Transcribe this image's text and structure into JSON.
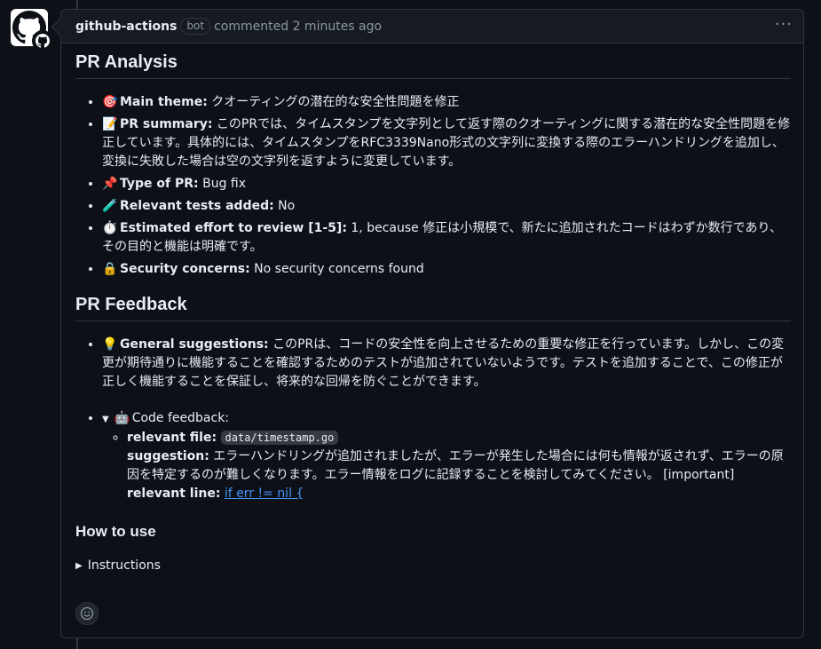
{
  "header": {
    "author": "github-actions",
    "badge": "bot",
    "time": "commented 2 minutes ago",
    "menu": "···"
  },
  "analysis": {
    "title": "PR Analysis",
    "items": [
      {
        "emoji": "🎯",
        "label": "Main theme:",
        "text": " クオーティングの潜在的な安全性問題を修正"
      },
      {
        "emoji": "📝",
        "label": "PR summary:",
        "text": " このPRでは、タイムスタンプを文字列として返す際のクオーティングに関する潜在的な安全性問題を修正しています。具体的には、タイムスタンプをRFC3339Nano形式の文字列に変換する際のエラーハンドリングを追加し、変換に失敗した場合は空の文字列を返すように変更しています。"
      },
      {
        "emoji": "📌",
        "label": "Type of PR:",
        "text": " Bug fix"
      },
      {
        "emoji": "🧪",
        "label": "Relevant tests added:",
        "text": " No"
      },
      {
        "emoji": "⏱️",
        "label": "Estimated effort to review [1-5]:",
        "text": " 1, because 修正は小規模で、新たに追加されたコードはわずか数行であり、その目的と機能は明確です。"
      },
      {
        "emoji": "🔒",
        "label": "Security concerns:",
        "text": " No security concerns found"
      }
    ]
  },
  "feedback": {
    "title": "PR Feedback",
    "general_emoji": "💡",
    "general_label": "General suggestions:",
    "general_text": " このPRは、コードの安全性を向上させるための重要な修正を行っています。しかし、この変更が期待通りに機能することを確認するためのテストが追加されていないようです。テストを追加することで、この修正が正しく機能することを保証し、将来的な回帰を防ぐことができます。",
    "code_arrow": "▼",
    "code_emoji": "🤖",
    "code_label": "Code feedback:",
    "file_label": "relevant file:",
    "file_value": "data/timestamp.go",
    "suggestion_label": "suggestion:",
    "suggestion_text": " エラーハンドリングが追加されましたが、エラーが発生した場合には何も情報が返されず、エラーの原因を特定するのが難しくなります。エラー情報をログに記録することを検討してみてください。 [important]",
    "line_label": "relevant line:",
    "line_value": "if err != nil {"
  },
  "howto": {
    "title": "How to use",
    "arrow": "▶",
    "instructions": "Instructions"
  },
  "reaction": {
    "icon": "smiley-icon"
  }
}
